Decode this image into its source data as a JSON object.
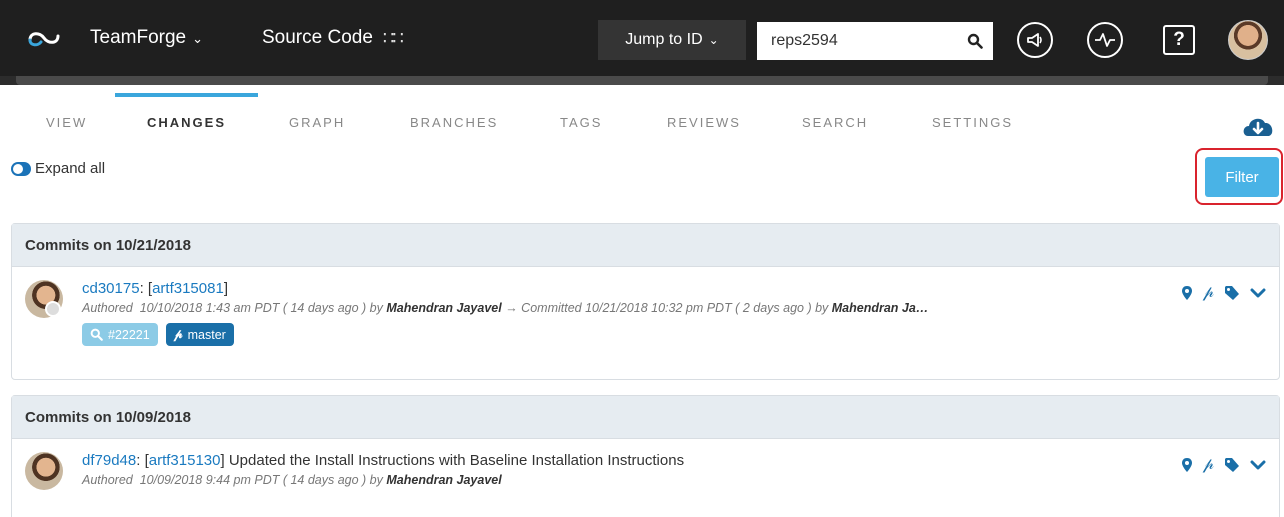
{
  "topbar": {
    "brand": "TeamForge",
    "module": "Source Code",
    "jump_label": "Jump to ID",
    "search_value": "reps2594"
  },
  "tabs": [
    {
      "label": "VIEW"
    },
    {
      "label": "CHANGES"
    },
    {
      "label": "GRAPH"
    },
    {
      "label": "BRANCHES"
    },
    {
      "label": "TAGS"
    },
    {
      "label": "REVIEWS"
    },
    {
      "label": "SEARCH"
    },
    {
      "label": "SETTINGS"
    }
  ],
  "active_tab": "CHANGES",
  "expand_label": "Expand all",
  "filter_label": "Filter",
  "groups": [
    {
      "header": "Commits on 10/21/2018",
      "commit": {
        "id": "cd30175",
        "artifact": "artf315081",
        "message": "",
        "authored_prefix": "Authored",
        "authored": "10/10/2018 1:43 am PDT ( 14 days ago ) by",
        "author": "Mahendran Jayavel",
        "committed": "→ Committed 10/21/2018 10:32 pm PDT ( 2 days ago ) by",
        "committer": "Mahendran Ja…",
        "review": "#22221",
        "branch": "master"
      }
    },
    {
      "header": "Commits on 10/09/2018",
      "commit": {
        "id": "df79d48",
        "artifact": "artf315130",
        "message": "Updated the Install Instructions with Baseline Installation Instructions",
        "authored_prefix": "Authored",
        "authored": "10/09/2018 9:44 pm PDT ( 14 days ago ) by",
        "author": "Mahendran Jayavel"
      }
    }
  ],
  "colors": {
    "accent": "#3aa6dc",
    "link": "#1a7ac0",
    "filter": "#49b3e6",
    "highlight": "#d9232d"
  }
}
